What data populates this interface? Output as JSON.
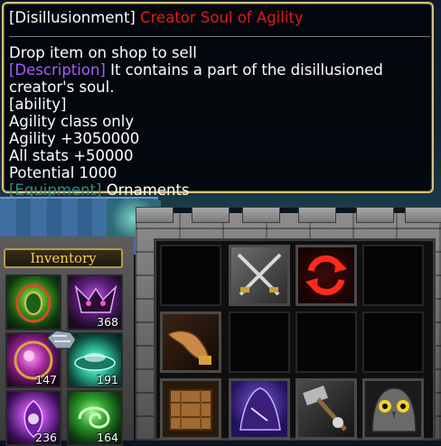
{
  "tooltip": {
    "title_tag": "[Disillusionment]",
    "title_name": "Creator Soul of Agility",
    "hint": "Drop item on shop to sell",
    "desc_tag": "[Description]",
    "desc_text_1": " It contains a part of the disillusioned",
    "desc_text_2": "creator's soul.",
    "ability_tag": "[ability]",
    "stats": [
      "Agility class only",
      "Agility +3050000",
      "All stats +50000",
      "Potential 1000"
    ],
    "equip_tag": "[Equipment]",
    "equip_value": " Ornaments"
  },
  "inventory": {
    "label": "Inventory",
    "items": [
      {
        "icon": "green-orb-icon",
        "count": ""
      },
      {
        "icon": "purple-beast-icon",
        "count": "368"
      },
      {
        "icon": "purple-sphere-icon",
        "count": "147"
      },
      {
        "icon": "teal-bowl-icon",
        "count": "191"
      },
      {
        "icon": "purple-spirit-icon",
        "count": "236"
      },
      {
        "icon": "green-swirl-icon",
        "count": "164"
      }
    ]
  },
  "shop": {
    "items": [
      "crossed-swords-icon",
      "red-cycle-icon",
      "hand-icon",
      "wooden-crate-icon",
      "purple-hood-icon",
      "war-hammer-icon",
      "owl-icon"
    ]
  },
  "colors": {
    "title_name": "#e21a1a",
    "tag_purple": "#a45bff",
    "tag_green": "#22dd22",
    "tag_teal": "#2c8a8a",
    "inventory_label": "#f2d14a",
    "tooltip_border": "#d8c27a"
  }
}
